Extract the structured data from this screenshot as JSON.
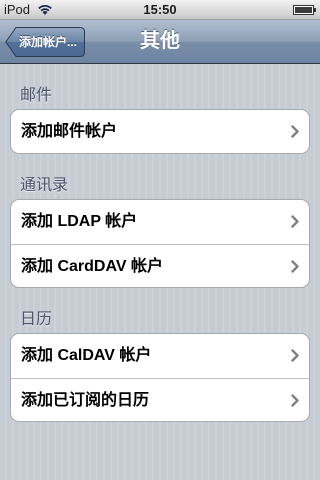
{
  "status_bar": {
    "carrier": "iPod",
    "time": "15:50"
  },
  "nav": {
    "back_label": "添加帐户...",
    "title": "其他"
  },
  "sections": [
    {
      "header": "邮件",
      "items": [
        "添加邮件帐户"
      ]
    },
    {
      "header": "通讯录",
      "items": [
        "添加 LDAP 帐户",
        "添加 CardDAV 帐户"
      ]
    },
    {
      "header": "日历",
      "items": [
        "添加 CalDAV 帐户",
        "添加已订阅的日历"
      ]
    }
  ],
  "colors": {
    "nav_bar": "#6d83a1",
    "background": "#c5ccd4",
    "section_header": "#4c566c"
  },
  "icons": {
    "wifi": "wifi-icon",
    "battery": "battery-icon",
    "chevron": "chevron-right-icon"
  }
}
